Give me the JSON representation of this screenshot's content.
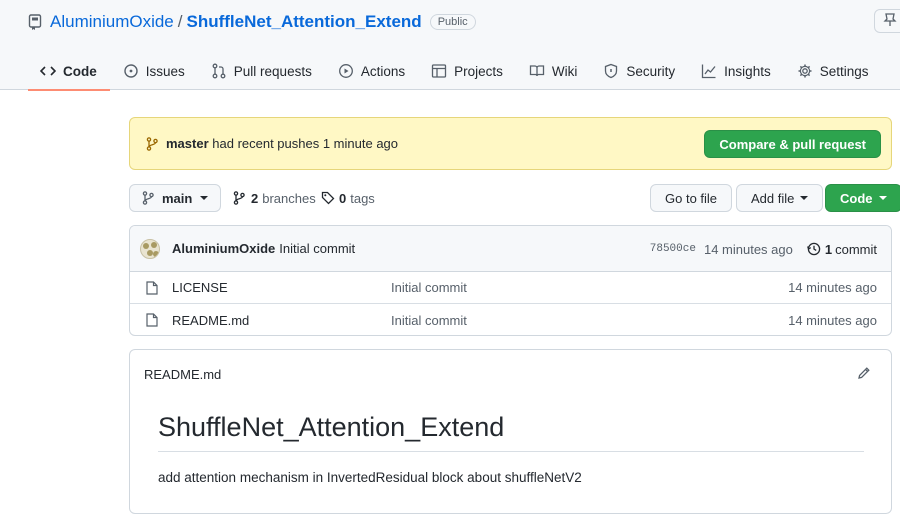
{
  "repo": {
    "owner": "AluminiumOxide",
    "separator": "/",
    "name": "ShuffleNet_Attention_Extend",
    "visibility": "Public"
  },
  "tabs": [
    {
      "label": "Code",
      "icon": "code-icon",
      "active": true
    },
    {
      "label": "Issues",
      "icon": "issue-icon"
    },
    {
      "label": "Pull requests",
      "icon": "pull-request-icon"
    },
    {
      "label": "Actions",
      "icon": "play-icon"
    },
    {
      "label": "Projects",
      "icon": "table-icon"
    },
    {
      "label": "Wiki",
      "icon": "book-icon"
    },
    {
      "label": "Security",
      "icon": "shield-icon"
    },
    {
      "label": "Insights",
      "icon": "graph-icon"
    },
    {
      "label": "Settings",
      "icon": "gear-icon"
    }
  ],
  "flash": {
    "branch": "master",
    "message": "had recent pushes 1 minute ago",
    "button": "Compare & pull request"
  },
  "filenav": {
    "branch": "main",
    "branches_count": "2",
    "branches_label": "branches",
    "tags_count": "0",
    "tags_label": "tags",
    "go_to_file": "Go to file",
    "add_file": "Add file",
    "code": "Code"
  },
  "latest_commit": {
    "author": "AluminiumOxide",
    "message": "Initial commit",
    "sha": "78500ce",
    "age": "14 minutes ago",
    "commit_count": "1",
    "commit_label": "commit"
  },
  "files": [
    {
      "name": "LICENSE",
      "commit": "Initial commit",
      "age": "14 minutes ago"
    },
    {
      "name": "README.md",
      "commit": "Initial commit",
      "age": "14 minutes ago"
    }
  ],
  "readme": {
    "filename": "README.md",
    "heading": "ShuffleNet_Attention_Extend",
    "body": "add attention mechanism in InvertedResidual block about shuffleNetV2"
  },
  "colors": {
    "accent_link": "#0969da",
    "primary_button": "#2da44e",
    "active_tab_underline": "#fd8c73",
    "flash_bg": "#fff8c5"
  }
}
